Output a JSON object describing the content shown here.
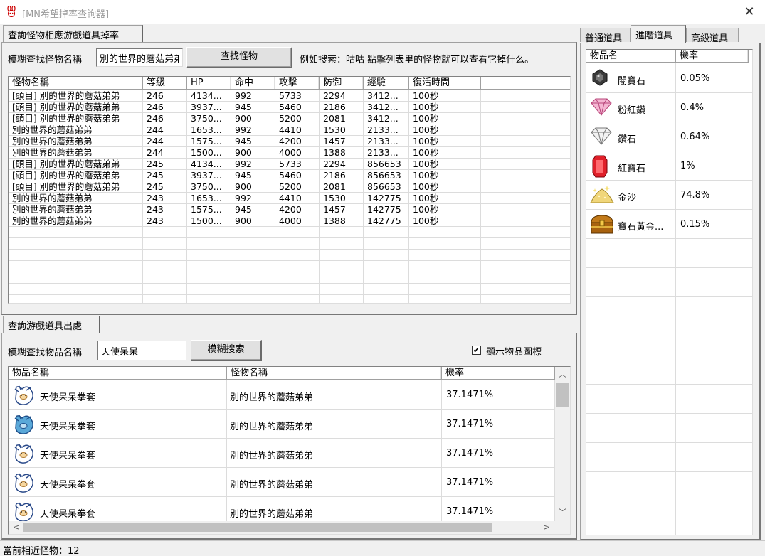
{
  "window": {
    "title": "[MN希望掉率查詢器]",
    "close_glyph": "✕"
  },
  "monster_search": {
    "tab_label": "查詢怪物相應游戲道具掉率",
    "field_label": "模糊查找怪物名稱",
    "field_value": "別的世界的蘑菇弟弟",
    "button_label": "查找怪物",
    "hint": "例如搜索：咕咕 點擊列表里的怪物就可以查看它掉什么。",
    "columns": [
      "怪物名稱",
      "等級",
      "HP",
      "命中",
      "攻擊",
      "防御",
      "經驗",
      "復活時間"
    ],
    "rows": [
      [
        "[頭目] 別的世界的蘑菇弟弟",
        "246",
        "4134...",
        "992",
        "5733",
        "2294",
        "3412...",
        "100秒"
      ],
      [
        "[頭目] 別的世界的蘑菇弟弟",
        "246",
        "3937...",
        "945",
        "5460",
        "2186",
        "3412...",
        "100秒"
      ],
      [
        "[頭目] 別的世界的蘑菇弟弟",
        "246",
        "3750...",
        "900",
        "5200",
        "2081",
        "3412...",
        "100秒"
      ],
      [
        "別的世界的蘑菇弟弟",
        "244",
        "1653...",
        "992",
        "4410",
        "1530",
        "2133...",
        "100秒"
      ],
      [
        "別的世界的蘑菇弟弟",
        "244",
        "1575...",
        "945",
        "4200",
        "1457",
        "2133...",
        "100秒"
      ],
      [
        "別的世界的蘑菇弟弟",
        "244",
        "1500...",
        "900",
        "4000",
        "1388",
        "2133...",
        "100秒"
      ],
      [
        "[頭目] 別的世界的蘑菇弟弟",
        "245",
        "4134...",
        "992",
        "5733",
        "2294",
        "856653",
        "100秒"
      ],
      [
        "[頭目] 別的世界的蘑菇弟弟",
        "245",
        "3937...",
        "945",
        "5460",
        "2186",
        "856653",
        "100秒"
      ],
      [
        "[頭目] 別的世界的蘑菇弟弟",
        "245",
        "3750...",
        "900",
        "5200",
        "2081",
        "856653",
        "100秒"
      ],
      [
        "別的世界的蘑菇弟弟",
        "243",
        "1653...",
        "992",
        "4410",
        "1530",
        "142775",
        "100秒"
      ],
      [
        "別的世界的蘑菇弟弟",
        "243",
        "1575...",
        "945",
        "4200",
        "1457",
        "142775",
        "100秒"
      ],
      [
        "別的世界的蘑菇弟弟",
        "243",
        "1500...",
        "900",
        "4000",
        "1388",
        "142775",
        "100秒"
      ]
    ]
  },
  "item_search": {
    "tab_label": "查詢游戲道具出處",
    "field_label": "模糊查找物品名稱",
    "field_value": "天使呆呆",
    "button_label": "模糊搜索",
    "checkbox_label": "顯示物品圖標",
    "checkbox_checked": true,
    "check_glyph": "✔",
    "columns": [
      "物品名稱",
      "怪物名稱",
      "機率"
    ],
    "rows": [
      {
        "icon": "glove-icon",
        "item": "天使呆呆拳套",
        "monster": "別的世界的蘑菇弟弟",
        "rate": "37.1471%"
      },
      {
        "icon": "glove-icon",
        "item": "天使呆呆拳套",
        "monster": "別的世界的蘑菇弟弟",
        "rate": "37.1471%"
      },
      {
        "icon": "glove-icon",
        "item": "天使呆呆拳套",
        "monster": "別的世界的蘑菇弟弟",
        "rate": "37.1471%"
      },
      {
        "icon": "glove-icon",
        "item": "天使呆呆拳套",
        "monster": "別的世界的蘑菇弟弟",
        "rate": "37.1471%"
      },
      {
        "icon": "glove-icon",
        "item": "天使呆呆拳套",
        "monster": "別的世界的蘑菇弟弟",
        "rate": "37.1471%"
      }
    ],
    "scroll_up": "︿",
    "scroll_down": "﹀",
    "scroll_left": "<",
    "scroll_right": ">"
  },
  "drops_panel": {
    "tabs": [
      "普通道具",
      "進階道具",
      "高級道具"
    ],
    "active_tab": 1,
    "columns": [
      "物品名",
      "機率"
    ],
    "rows": [
      {
        "icon": "dark-gem-icon",
        "name": "闇寶石",
        "rate": "0.05%"
      },
      {
        "icon": "pink-diamond-icon",
        "name": "粉紅鑽",
        "rate": "0.4%"
      },
      {
        "icon": "diamond-icon",
        "name": "鑽石",
        "rate": "0.64%"
      },
      {
        "icon": "ruby-icon",
        "name": "紅寶石",
        "rate": "1%"
      },
      {
        "icon": "gold-sand-icon",
        "name": "金沙",
        "rate": "74.8%"
      },
      {
        "icon": "treasure-chest-icon",
        "name": "寶石黃金...",
        "rate": "0.15%"
      }
    ]
  },
  "status": {
    "text": "當前相近怪物：12"
  },
  "colors": {
    "title_text": "#9a9a9a",
    "panel_bg": "#f0f0f0",
    "list_bg": "#ffffff",
    "grid_line": "#dcdcdc"
  }
}
